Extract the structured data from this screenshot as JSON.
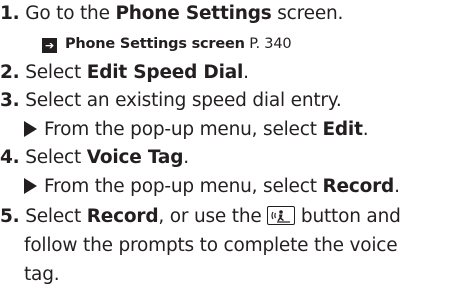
{
  "steps": [
    {
      "num": "1.",
      "pre": "Go to the ",
      "bold": "Phone Settings",
      "post": " screen."
    },
    {
      "num": "2.",
      "pre": "Select ",
      "bold": "Edit Speed Dial",
      "post": "."
    },
    {
      "num": "3.",
      "text": "Select an existing speed dial entry."
    },
    {
      "num": "4.",
      "pre": "Select ",
      "bold": "Voice Tag",
      "post": "."
    },
    {
      "num": "5.",
      "pre": "Select ",
      "bold": "Record",
      "post": ", or use the",
      "post2": " button and",
      "cont1": "follow the prompts to complete the voice",
      "cont2": "tag."
    }
  ],
  "reference": {
    "bold": "Phone Settings screen",
    "page": " P. 340"
  },
  "substeps": {
    "s3": {
      "pre": "From the pop-up menu, select ",
      "bold": "Edit",
      "post": "."
    },
    "s4": {
      "pre": "From the pop-up menu, select ",
      "bold": "Record",
      "post": "."
    }
  },
  "icons": {
    "reference": "reference-arrow-icon",
    "substep": "triangle-bullet-icon",
    "talk": "talk-button-icon"
  },
  "colors": {
    "text": "#231f20"
  }
}
